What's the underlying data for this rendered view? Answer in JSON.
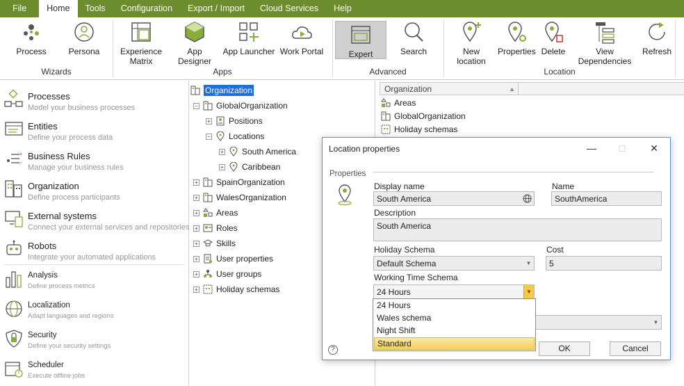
{
  "menu": [
    "File",
    "Home",
    "Tools",
    "Configuration",
    "Export / Import",
    "Cloud Services",
    "Help"
  ],
  "ribbon": {
    "wizards": {
      "label": "Wizards",
      "process": "Process",
      "persona": "Persona"
    },
    "apps": {
      "label": "Apps",
      "experience_matrix_1": "Experience",
      "experience_matrix_2": "Matrix",
      "app_designer": "App Designer",
      "app_launcher": "App Launcher",
      "work_portal": "Work Portal"
    },
    "advanced": {
      "label": "Advanced",
      "expert": "Expert",
      "search": "Search"
    },
    "location": {
      "label": "Location",
      "new_location": "New location",
      "properties": "Properties",
      "delete": "Delete",
      "view_dependencies": "View Dependencies",
      "refresh": "Refresh"
    }
  },
  "nav": [
    {
      "title": "Processes",
      "sub": "Model your business processes"
    },
    {
      "title": "Entities",
      "sub": "Define your process data"
    },
    {
      "title": "Business Rules",
      "sub": "Manage your business rules"
    },
    {
      "title": "Organization",
      "sub": "Define process participants"
    },
    {
      "title": "External systems",
      "sub": "Connect your external services and repositories"
    },
    {
      "title": "Robots",
      "sub": "Integrate your automated applications"
    },
    {
      "title": "Analysis",
      "sub": "Define process metrics"
    },
    {
      "title": "Localization",
      "sub": "Adapt languages and regions"
    },
    {
      "title": "Security",
      "sub": "Define your security settings"
    },
    {
      "title": "Scheduler",
      "sub": "Execute offline jobs"
    }
  ],
  "tree": {
    "root": "Organization",
    "global": "GlobalOrganization",
    "positions": "Positions",
    "locations": "Locations",
    "south_america": "South America",
    "caribbean": "Caribbean",
    "spain": "SpainOrganization",
    "wales": "WalesOrganization",
    "areas": "Areas",
    "roles": "Roles",
    "skills": "Skills",
    "user_properties": "User properties",
    "user_groups": "User groups",
    "holiday_schemas": "Holiday schemas"
  },
  "list": {
    "header": "Organization",
    "rows": [
      "Areas",
      "GlobalOrganization",
      "Holiday schemas"
    ]
  },
  "dialog": {
    "title": "Location properties",
    "section": "Properties",
    "display_name_label": "Display name",
    "display_name": "South America",
    "name_label": "Name",
    "name": "SouthAmerica",
    "description_label": "Description",
    "description": "South America",
    "holiday_label": "Holiday Schema",
    "holiday": "Default Schema",
    "cost_label": "Cost",
    "cost": "5",
    "working_label": "Working Time Schema",
    "working": "24 Hours",
    "options": [
      "24 Hours",
      "Wales schema",
      "Night Shift",
      "Standard"
    ],
    "ok": "OK",
    "cancel": "Cancel",
    "help": "?"
  },
  "colors": {
    "menubar": "#6c8c2e",
    "selection": "#1e6fd9",
    "accent": "#8aac3a"
  }
}
